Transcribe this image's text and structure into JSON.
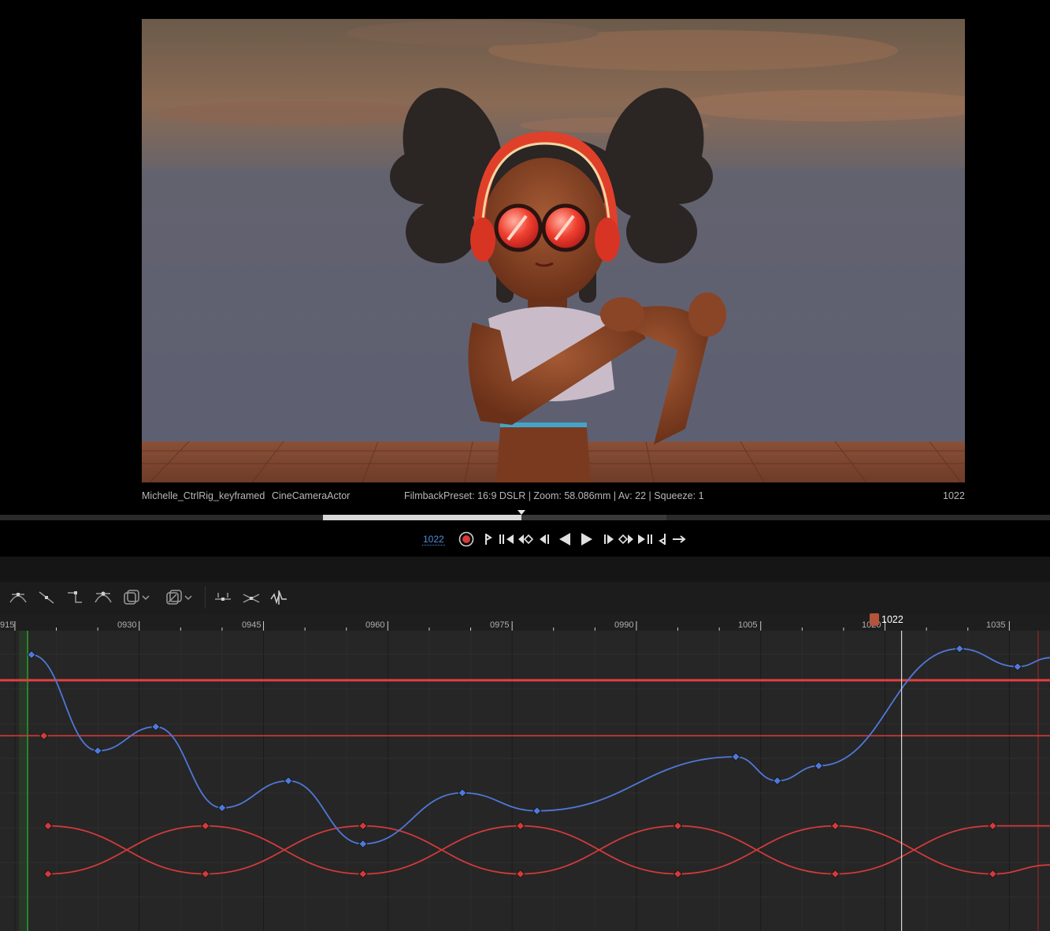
{
  "viewport": {
    "actor_label": "Michelle_CtrlRig_keyframed",
    "camera_label": "CineCameraActor",
    "filmback_info": "FilmbackPreset: 16:9 DSLR | Zoom: 58.086mm | Av: 22 | Squeeze: 1",
    "frame_number": "1022"
  },
  "transport": {
    "current_frame": "1022",
    "buttons": [
      "record",
      "jump-to-start",
      "step-to-previous-key",
      "previous-keyframe",
      "step-back-frame",
      "play-reverse",
      "play",
      "step-forward-frame",
      "next-keyframe",
      "step-to-next-key",
      "jump-to-end",
      "loop"
    ]
  },
  "toolbar": {
    "tools": [
      "auto-tangent-icon",
      "linear-tangent-icon",
      "constant-tangent-icon",
      "weighted-tangent-icon",
      "curve-options-dropdown-icon",
      "view-options-dropdown-icon",
      "flatten-tangents-icon",
      "straighten-tangents-icon",
      "curve-filter-icon"
    ]
  },
  "ruler": {
    "ticks": [
      "915",
      "0930",
      "0945",
      "0960",
      "0975",
      "0990",
      "1005",
      "1020",
      "1035"
    ],
    "current_frame": "1022"
  },
  "colors": {
    "blue_curve": "#4f78d8",
    "red_curve": "#d43a3a",
    "playhead": "#b3543c",
    "start_marker": "#2f9a2f"
  },
  "curves": {
    "frame_range": [
      915,
      1040
    ],
    "blue_keys": [
      [
        917,
        0.92
      ],
      [
        925,
        0.6
      ],
      [
        932,
        0.68
      ],
      [
        940,
        0.41
      ],
      [
        948,
        0.5
      ],
      [
        957,
        0.29
      ],
      [
        969,
        0.46
      ],
      [
        978,
        0.4
      ],
      [
        1002,
        0.58
      ],
      [
        1007,
        0.5
      ],
      [
        1012,
        0.55
      ],
      [
        1029,
        0.94
      ],
      [
        1036,
        0.88
      ],
      [
        1040,
        0.91
      ]
    ],
    "red_flat_high": 0.835,
    "red_flat_low": 0.65,
    "red_wave_a": [
      [
        919,
        0.19
      ],
      [
        938,
        0.35
      ],
      [
        957,
        0.19
      ],
      [
        976,
        0.35
      ],
      [
        995,
        0.19
      ],
      [
        1014,
        0.35
      ],
      [
        1033,
        0.19
      ],
      [
        1040,
        0.22
      ]
    ],
    "red_wave_b": [
      [
        919,
        0.35
      ],
      [
        938,
        0.19
      ],
      [
        957,
        0.35
      ],
      [
        976,
        0.19
      ],
      [
        995,
        0.35
      ],
      [
        1014,
        0.19
      ],
      [
        1033,
        0.35
      ],
      [
        1040,
        0.35
      ]
    ]
  }
}
